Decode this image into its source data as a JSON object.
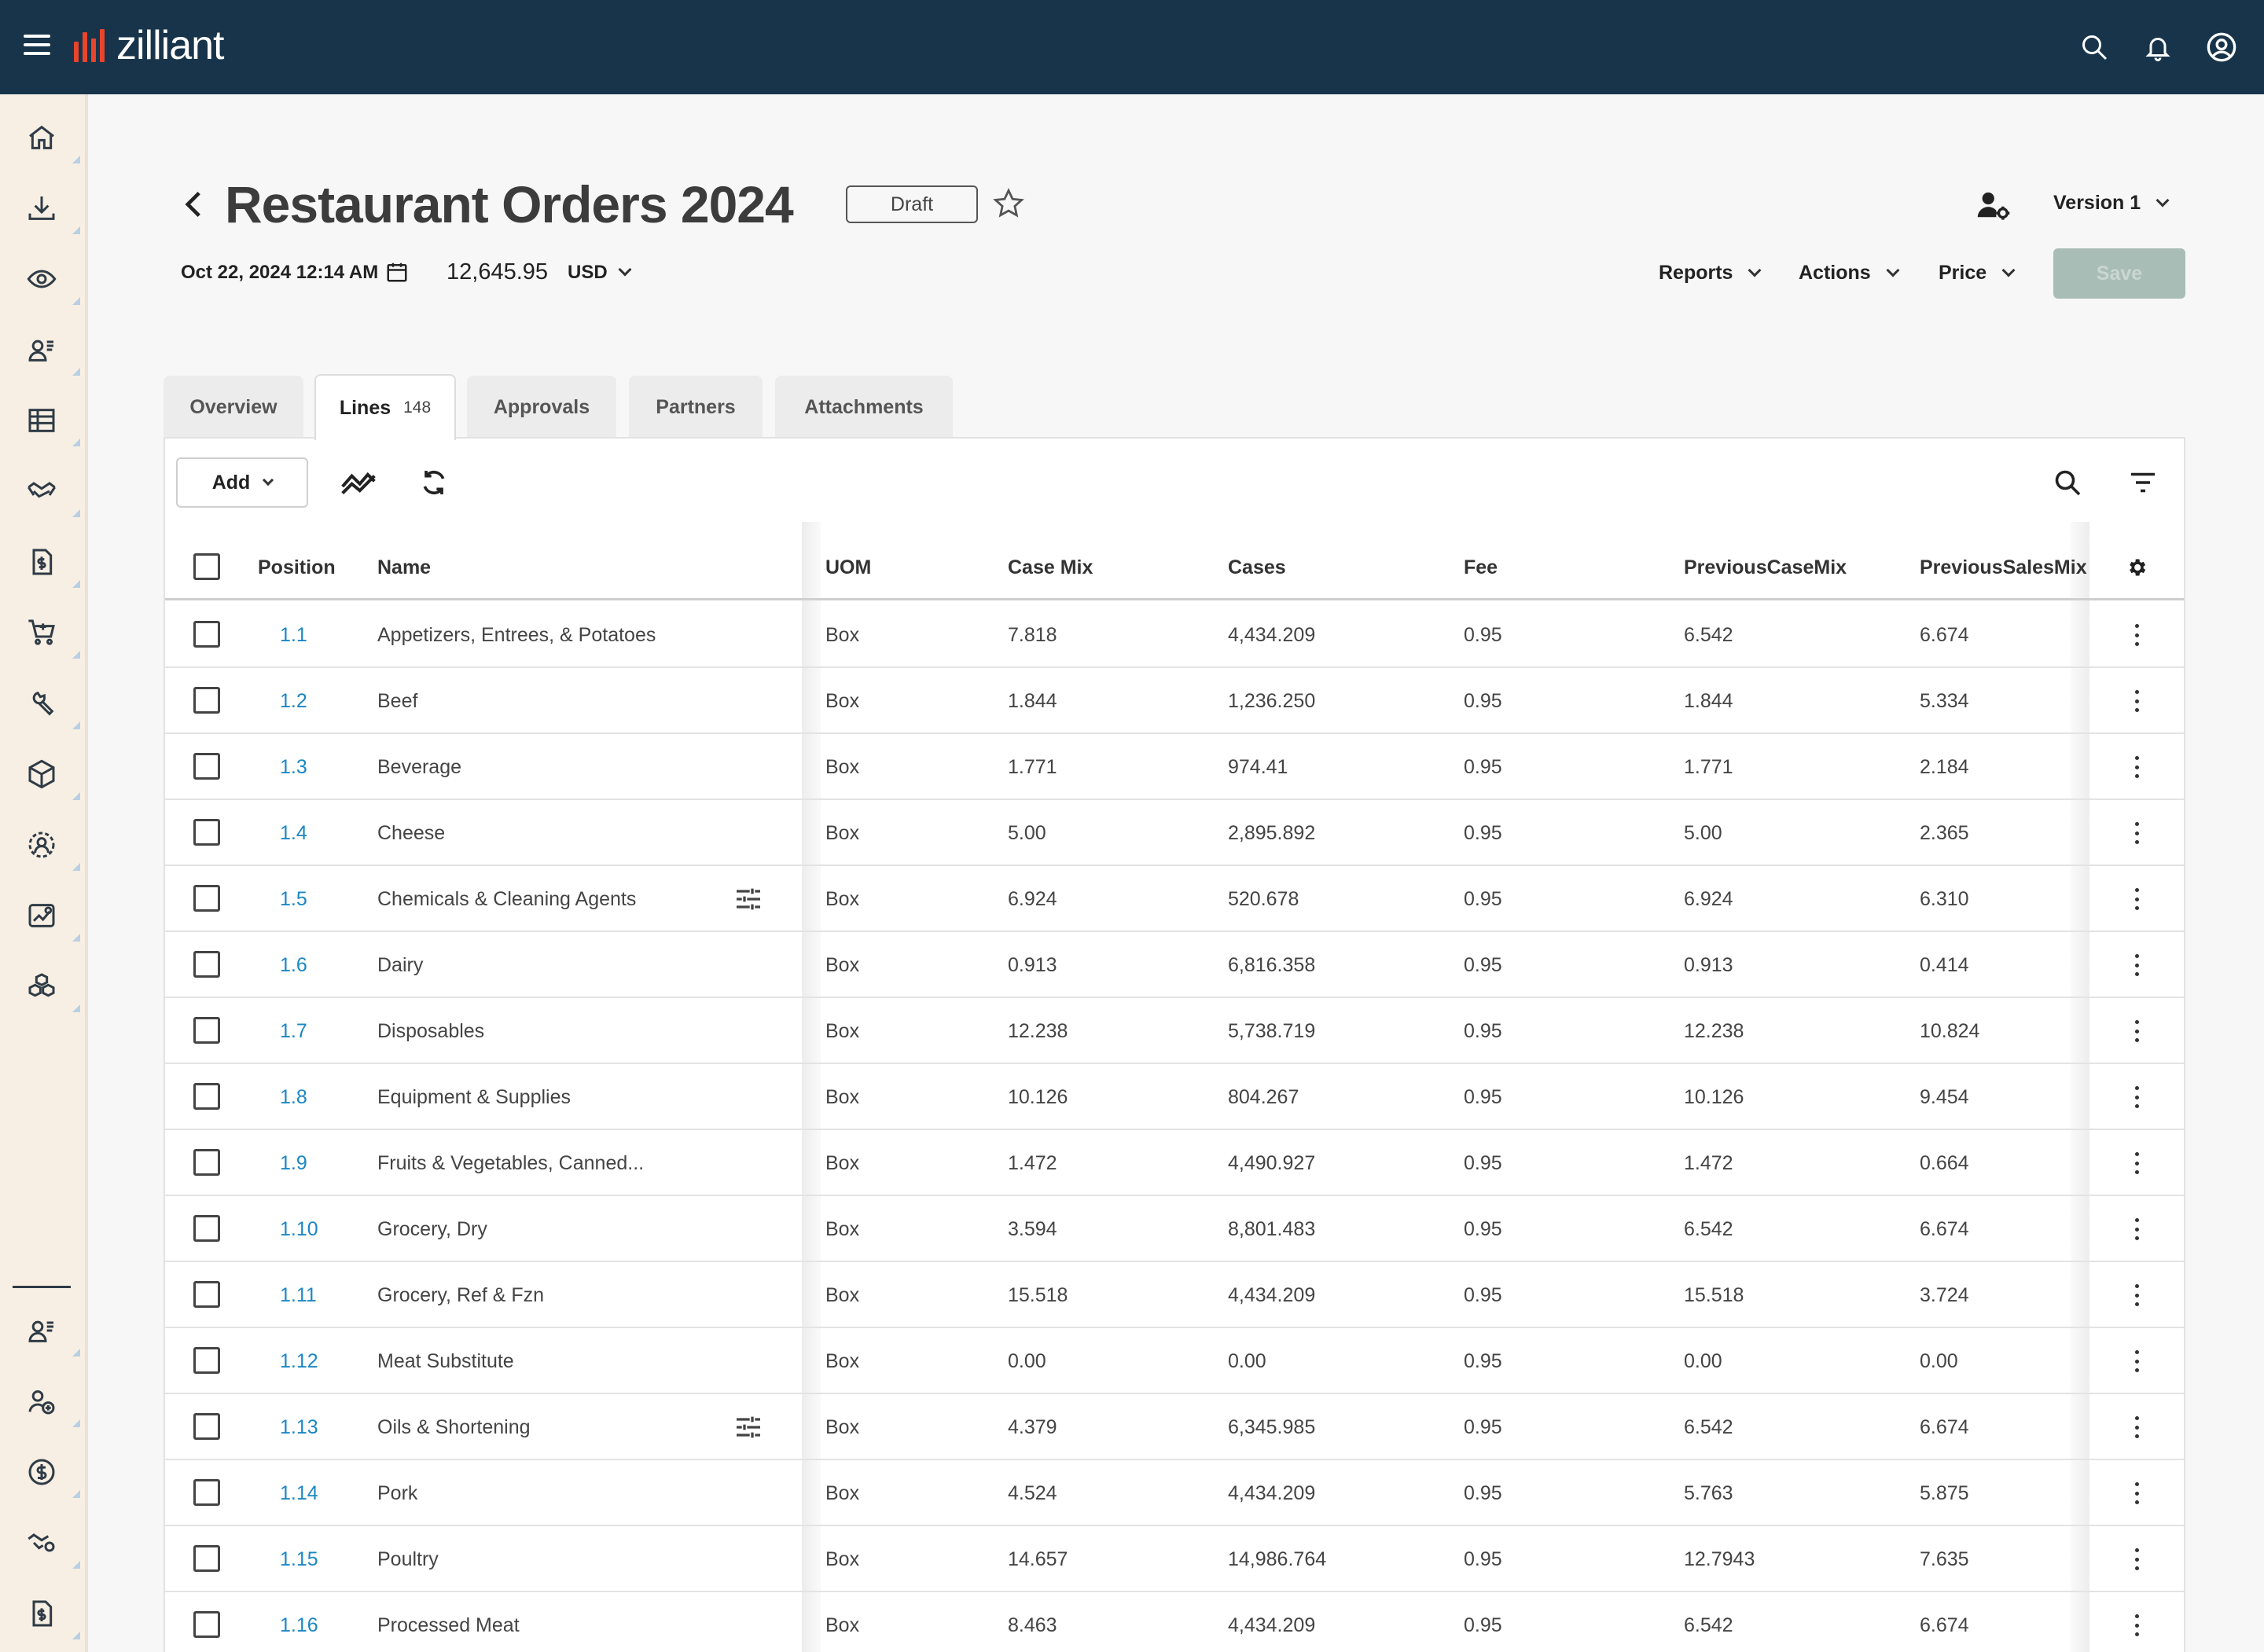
{
  "app": {
    "logo_text": "zilliant",
    "brand_color": "#e8452c",
    "header_bg": "#17344b",
    "top_icons": [
      "search-icon",
      "bell-icon",
      "account-icon"
    ]
  },
  "nav": {
    "items": [
      "home-icon",
      "download-icon",
      "eye-icon",
      "user-list-icon",
      "table-icon",
      "handshake-icon",
      "document-dollar-icon",
      "cart-icon",
      "tools-icon",
      "cube-icon",
      "user-gear-icon",
      "chart-icon",
      "boxes-icon"
    ],
    "bottom_items": [
      "user-list-icon",
      "user-add-icon",
      "dollar-icon",
      "handshake-gear-icon",
      "document-dollar-icon"
    ]
  },
  "header": {
    "title": "Restaurant Orders 2024",
    "status": "Draft",
    "date": "Oct 22, 2024 12:14 AM",
    "amount": "12,645.95",
    "currency": "USD",
    "version": "Version 1",
    "menus": [
      "Reports",
      "Actions",
      "Price"
    ],
    "save_label": "Save"
  },
  "tabs": [
    {
      "label": "Overview"
    },
    {
      "label": "Lines",
      "count": "148",
      "active": true
    },
    {
      "label": "Approvals"
    },
    {
      "label": "Partners"
    },
    {
      "label": "Attachments"
    }
  ],
  "toolbar": {
    "add_label": "Add"
  },
  "table": {
    "columns": [
      "Position",
      "Name",
      "UOM",
      "Case Mix",
      "Cases",
      "Fee",
      "PreviousCaseMix",
      "PreviousSalesMix"
    ],
    "rows": [
      {
        "pos": "1.1",
        "name": "Appetizers, Entrees, & Potatoes",
        "uom": "Box",
        "case_mix": "7.818",
        "cases": "4,434.209",
        "fee": "0.95",
        "prev_case_mix": "6.542",
        "prev_sales_mix": "6.674"
      },
      {
        "pos": "1.2",
        "name": "Beef",
        "uom": "Box",
        "case_mix": "1.844",
        "cases": "1,236.250",
        "fee": "0.95",
        "prev_case_mix": "1.844",
        "prev_sales_mix": "5.334"
      },
      {
        "pos": "1.3",
        "name": "Beverage",
        "uom": "Box",
        "case_mix": "1.771",
        "cases": "974.41",
        "fee": "0.95",
        "prev_case_mix": "1.771",
        "prev_sales_mix": "2.184"
      },
      {
        "pos": "1.4",
        "name": "Cheese",
        "uom": "Box",
        "case_mix": "5.00",
        "cases": "2,895.892",
        "fee": "0.95",
        "prev_case_mix": "5.00",
        "prev_sales_mix": "2.365"
      },
      {
        "pos": "1.5",
        "name": "Chemicals & Cleaning Agents",
        "uom": "Box",
        "case_mix": "6.924",
        "cases": "520.678",
        "fee": "0.95",
        "prev_case_mix": "6.924",
        "prev_sales_mix": "6.310",
        "tune": true
      },
      {
        "pos": "1.6",
        "name": "Dairy",
        "uom": "Box",
        "case_mix": "0.913",
        "cases": "6,816.358",
        "fee": "0.95",
        "prev_case_mix": "0.913",
        "prev_sales_mix": "0.414"
      },
      {
        "pos": "1.7",
        "name": "Disposables",
        "uom": "Box",
        "case_mix": "12.238",
        "cases": "5,738.719",
        "fee": "0.95",
        "prev_case_mix": "12.238",
        "prev_sales_mix": "10.824"
      },
      {
        "pos": "1.8",
        "name": "Equipment & Supplies",
        "uom": "Box",
        "case_mix": "10.126",
        "cases": "804.267",
        "fee": "0.95",
        "prev_case_mix": "10.126",
        "prev_sales_mix": "9.454"
      },
      {
        "pos": "1.9",
        "name": "Fruits & Vegetables, Canned...",
        "uom": "Box",
        "case_mix": "1.472",
        "cases": "4,490.927",
        "fee": "0.95",
        "prev_case_mix": "1.472",
        "prev_sales_mix": "0.664"
      },
      {
        "pos": "1.10",
        "name": "Grocery, Dry",
        "uom": "Box",
        "case_mix": "3.594",
        "cases": "8,801.483",
        "fee": "0.95",
        "prev_case_mix": "6.542",
        "prev_sales_mix": "6.674"
      },
      {
        "pos": "1.11",
        "name": "Grocery, Ref & Fzn",
        "uom": "Box",
        "case_mix": "15.518",
        "cases": "4,434.209",
        "fee": "0.95",
        "prev_case_mix": "15.518",
        "prev_sales_mix": "3.724"
      },
      {
        "pos": "1.12",
        "name": "Meat Substitute",
        "uom": "Box",
        "case_mix": "0.00",
        "cases": "0.00",
        "fee": "0.95",
        "prev_case_mix": "0.00",
        "prev_sales_mix": "0.00"
      },
      {
        "pos": "1.13",
        "name": "Oils & Shortening",
        "uom": "Box",
        "case_mix": "4.379",
        "cases": "6,345.985",
        "fee": "0.95",
        "prev_case_mix": "6.542",
        "prev_sales_mix": "6.674",
        "tune": true
      },
      {
        "pos": "1.14",
        "name": "Pork",
        "uom": "Box",
        "case_mix": "4.524",
        "cases": "4,434.209",
        "fee": "0.95",
        "prev_case_mix": "5.763",
        "prev_sales_mix": "5.875"
      },
      {
        "pos": "1.15",
        "name": "Poultry",
        "uom": "Box",
        "case_mix": "14.657",
        "cases": "14,986.764",
        "fee": "0.95",
        "prev_case_mix": "12.7943",
        "prev_sales_mix": "7.635"
      },
      {
        "pos": "1.16",
        "name": "Processed Meat",
        "uom": "Box",
        "case_mix": "8.463",
        "cases": "4,434.209",
        "fee": "0.95",
        "prev_case_mix": "6.542",
        "prev_sales_mix": "6.674"
      }
    ]
  }
}
